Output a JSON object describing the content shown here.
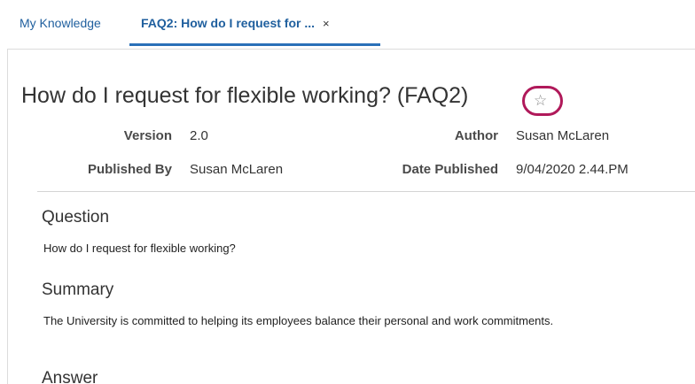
{
  "tabs": [
    {
      "label": "My Knowledge"
    },
    {
      "label": "FAQ2: How do I request for ...",
      "close": "×"
    }
  ],
  "article": {
    "title": "How do I request for flexible working? (FAQ2)",
    "star_icon": "☆",
    "meta": {
      "version_label": "Version",
      "version_value": "2.0",
      "author_label": "Author",
      "author_value": "Susan McLaren",
      "published_by_label": "Published By",
      "published_by_value": "Susan McLaren",
      "date_published_label": "Date Published",
      "date_published_value": "9/04/2020 2.44.PM"
    },
    "sections": {
      "question_heading": "Question",
      "question_body": "How do I request for flexible working?",
      "summary_heading": "Summary",
      "summary_body": "The University is committed to helping its employees balance their personal and work commitments.",
      "answer_heading": "Answer"
    }
  },
  "colors": {
    "tab_text": "#1f5f9e",
    "tab_underline": "#2a70b8",
    "highlight_ring": "#b0195a"
  }
}
